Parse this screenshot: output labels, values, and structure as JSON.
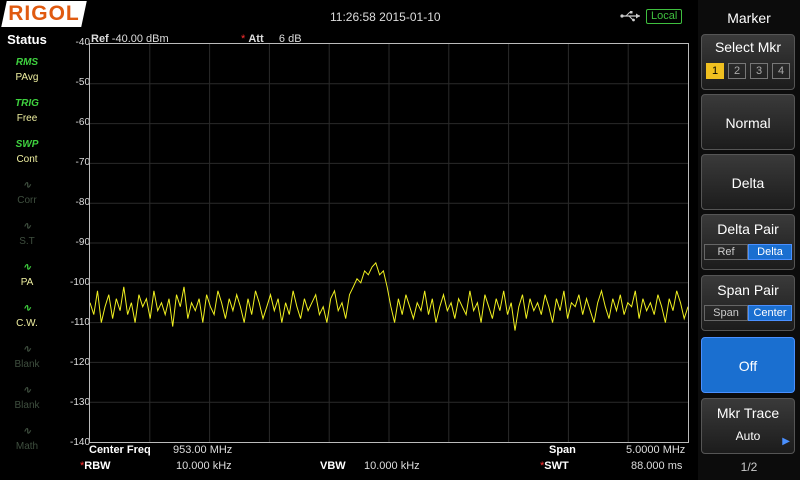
{
  "header": {
    "logo": "RIGOL",
    "datetime": "11:26:58 2015-01-10",
    "local_badge": "Local",
    "usb_icon": "usb-icon"
  },
  "status_panel": {
    "title": "Status",
    "items": [
      {
        "icon": "RMS",
        "label": "PAvg",
        "state": "active"
      },
      {
        "icon": "TRIG",
        "label": "Free",
        "state": "active"
      },
      {
        "icon": "SWP",
        "label": "Cont",
        "state": "active"
      },
      {
        "icon": "corr-icon",
        "label": "Corr",
        "state": "dim"
      },
      {
        "icon": "st-icon",
        "label": "S.T",
        "state": "dim"
      },
      {
        "icon": "pa-icon",
        "label": "PA",
        "state": "active"
      },
      {
        "icon": "cw-icon",
        "label": "C.W.",
        "state": "active"
      },
      {
        "icon": "blank-icon",
        "label": "Blank",
        "state": "dim"
      },
      {
        "icon": "blank-icon",
        "label": "Blank",
        "state": "dim"
      },
      {
        "icon": "math-icon",
        "label": "Math",
        "state": "dim"
      }
    ]
  },
  "plot": {
    "ref_label": "Ref",
    "ref_value": "-40.00 dBm",
    "att_label": "Att",
    "att_value": "6 dB"
  },
  "chart_data": {
    "type": "line",
    "ylim": [
      -140,
      -40
    ],
    "yticks": [
      "-40",
      "-50",
      "-60",
      "-70",
      "-80",
      "-90",
      "-100",
      "-110",
      "-120",
      "-130",
      "-140"
    ],
    "grid": true,
    "trace_color": "#f0f020",
    "series": [
      {
        "values": [
          -105,
          -108,
          -102,
          -110,
          -106,
          -103,
          -109,
          -104,
          -107,
          -101,
          -108,
          -105,
          -110,
          -103,
          -106,
          -104,
          -109,
          -102,
          -107,
          -105,
          -108,
          -104,
          -111,
          -103,
          -106,
          -101,
          -109,
          -105,
          -107,
          -104,
          -110,
          -103,
          -106,
          -108,
          -102,
          -105,
          -109,
          -104,
          -107,
          -103,
          -106,
          -110,
          -104,
          -108,
          -102,
          -105,
          -109,
          -106,
          -103,
          -107,
          -104,
          -110,
          -105,
          -108,
          -102,
          -106,
          -109,
          -104,
          -107,
          -105,
          -103,
          -108,
          -106,
          -110,
          -104,
          -102,
          -107,
          -105,
          -109,
          -103,
          -101,
          -99,
          -100,
          -97,
          -98,
          -96,
          -95,
          -98,
          -97,
          -101,
          -106,
          -110,
          -104,
          -108,
          -103,
          -106,
          -109,
          -105,
          -107,
          -102,
          -108,
          -104,
          -110,
          -106,
          -103,
          -107,
          -105,
          -109,
          -104,
          -106,
          -108,
          -102,
          -107,
          -105,
          -110,
          -103,
          -106,
          -109,
          -104,
          -107,
          -102,
          -108,
          -105,
          -112,
          -106,
          -103,
          -109,
          -104,
          -107,
          -105,
          -108,
          -103,
          -106,
          -110,
          -104,
          -107,
          -102,
          -109,
          -105,
          -106,
          -103,
          -108,
          -104,
          -107,
          -110,
          -105,
          -102,
          -106,
          -109,
          -104,
          -107,
          -103,
          -108,
          -105,
          -106,
          -102,
          -109,
          -104,
          -107,
          -105,
          -108,
          -103,
          -106,
          -110,
          -104,
          -107,
          -102,
          -105,
          -109,
          -106
        ]
      }
    ]
  },
  "footer": {
    "center_freq_label": "Center Freq",
    "center_freq_value": "953.00 MHz",
    "span_label": "Span",
    "span_value": "5.0000 MHz",
    "rbw_label": "RBW",
    "rbw_value": "10.000 kHz",
    "vbw_label": "VBW",
    "vbw_value": "10.000 kHz",
    "swt_label": "SWT",
    "swt_value": "88.000 ms"
  },
  "menu": {
    "title": "Marker",
    "select_mkr_label": "Select Mkr",
    "markers": [
      "1",
      "2",
      "3",
      "4"
    ],
    "normal_label": "Normal",
    "delta_label": "Delta",
    "delta_pair_label": "Delta Pair",
    "delta_pair_ref": "Ref",
    "delta_pair_delta": "Delta",
    "span_pair_label": "Span Pair",
    "span_pair_span": "Span",
    "span_pair_center": "Center",
    "off_label": "Off",
    "mkr_trace_label": "Mkr Trace",
    "mkr_trace_value": "Auto",
    "page": "1/2"
  }
}
